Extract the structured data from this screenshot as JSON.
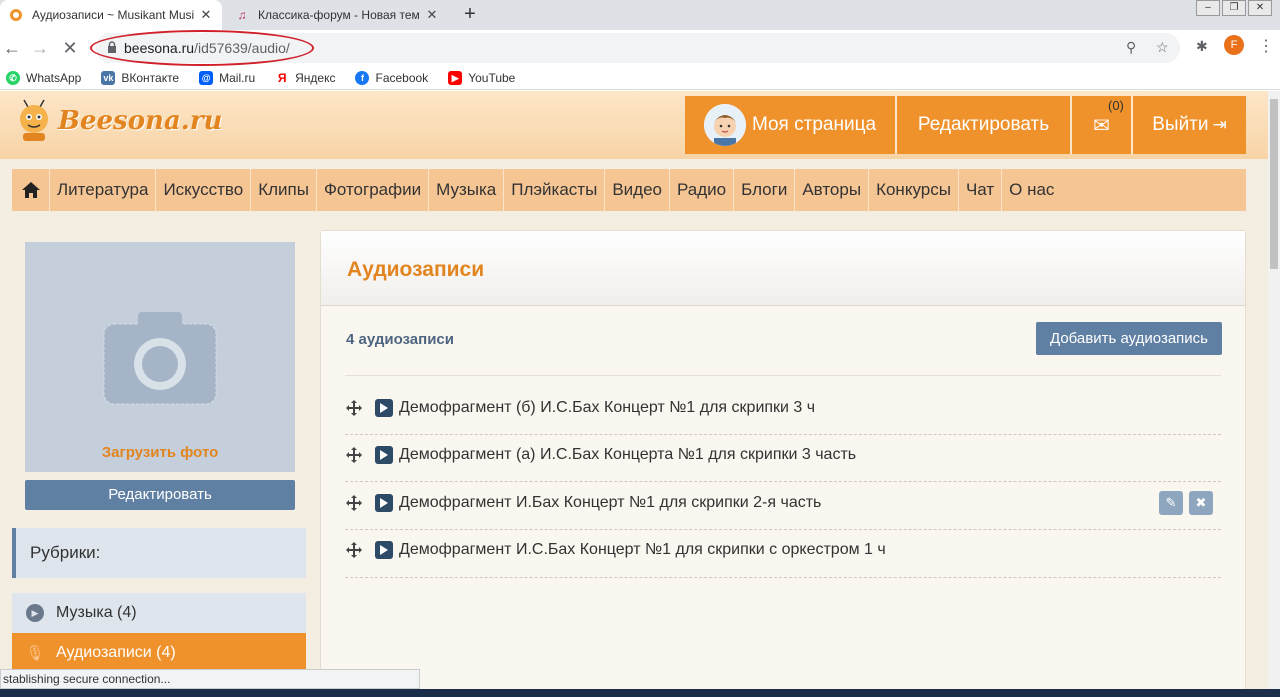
{
  "browser": {
    "tabs": [
      {
        "title": "Аудиозаписи ~ Musikant Musika",
        "active": true
      },
      {
        "title": "Классика-форум - Новая тема",
        "active": false
      }
    ],
    "new_tab": "+",
    "url_host": "beesona.ru",
    "url_path": "/id57639/audio/",
    "profile_initial": "F",
    "bookmarks": [
      {
        "label": "WhatsApp",
        "color": "#25d366"
      },
      {
        "label": "ВКонтакте",
        "color": "#4a76a8"
      },
      {
        "label": "Mail.ru",
        "color": "#005ff9"
      },
      {
        "label": "Яндекс",
        "color": "#ff0000"
      },
      {
        "label": "Facebook",
        "color": "#1877f2"
      },
      {
        "label": "YouTube",
        "color": "#ff0000"
      }
    ],
    "status_text": "stablishing secure connection..."
  },
  "site": {
    "logo": "Beesona.ru",
    "header_buttons": {
      "my_page": "Моя страница",
      "edit": "Редактировать",
      "messages_count": "(0)",
      "logout": "Выйти"
    },
    "nav": [
      "Литература",
      "Искусство",
      "Клипы",
      "Фотографии",
      "Музыка",
      "Плэйкасты",
      "Видео",
      "Радио",
      "Блоги",
      "Авторы",
      "Конкурсы",
      "Чат",
      "О нас"
    ]
  },
  "sidebar": {
    "upload_photo": "Загрузить фото",
    "edit_button": "Редактировать",
    "rubrics_title": "Рубрики:",
    "items": [
      {
        "label": "Музыка (4)"
      },
      {
        "label": "Аудиозаписи (4)"
      }
    ]
  },
  "main": {
    "title": "Аудиозаписи",
    "count": "4 аудиозаписи",
    "add_button": "Добавить аудиозапись",
    "tracks": [
      {
        "name": "Демофрагмент (б) И.С.Бах Концерт №1 для скрипки 3 ч"
      },
      {
        "name": "Демофрагмент (а) И.С.Бах Концерта №1 для скрипки 3 часть"
      },
      {
        "name": "Демофрагмент И.Бах Концерт №1 для скрипки 2-я часть"
      },
      {
        "name": "Демофрагмент И.С.Бах Концерт №1 для скрипки с оркестром 1 ч"
      }
    ]
  },
  "colors": {
    "accent_orange": "#f0922c",
    "title_orange": "#e28520",
    "blue_button": "#5f7fa3",
    "page_bg": "#f4ede2",
    "annotation_red": "#d0202a"
  }
}
